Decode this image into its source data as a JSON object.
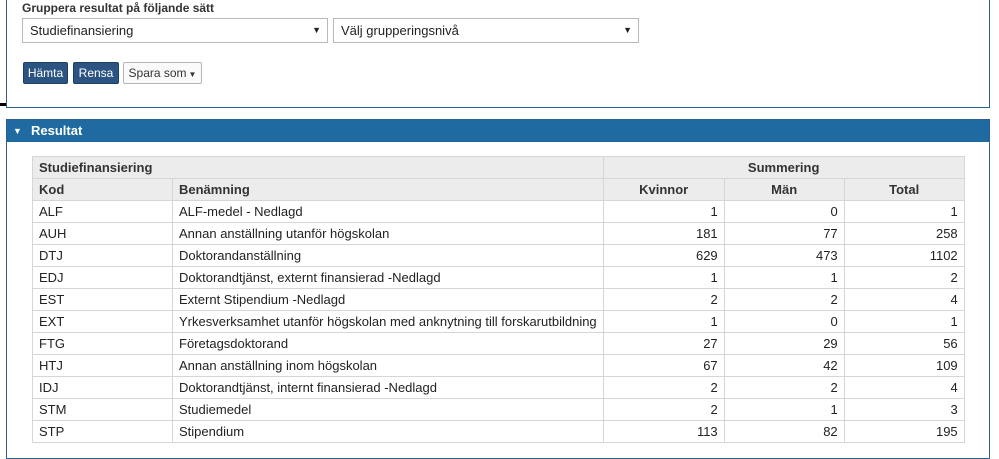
{
  "grouping": {
    "label": "Gruppera resultat på följande sätt",
    "primary_select": "Studiefinansiering",
    "secondary_select": "Välj grupperingsnivå"
  },
  "actions": {
    "fetch": "Hämta",
    "clear": "Rensa",
    "save_as": "Spara som"
  },
  "results": {
    "title": "Resultat",
    "group_header": "Studiefinansiering",
    "summary_header": "Summering",
    "columns": [
      "Kod",
      "Benämning",
      "Kvinnor",
      "Män",
      "Total"
    ],
    "rows": [
      {
        "kod": "ALF",
        "benamning": "ALF-medel - Nedlagd",
        "kvinnor": "1",
        "man": "0",
        "total": "1"
      },
      {
        "kod": "AUH",
        "benamning": "Annan anställning utanför högskolan",
        "kvinnor": "181",
        "man": "77",
        "total": "258"
      },
      {
        "kod": "DTJ",
        "benamning": "Doktorandanställning",
        "kvinnor": "629",
        "man": "473",
        "total": "1102"
      },
      {
        "kod": "EDJ",
        "benamning": "Doktorandtjänst, externt finansierad -Nedlagd",
        "kvinnor": "1",
        "man": "1",
        "total": "2"
      },
      {
        "kod": "EST",
        "benamning": "Externt Stipendium -Nedlagd",
        "kvinnor": "2",
        "man": "2",
        "total": "4"
      },
      {
        "kod": "EXT",
        "benamning": "Yrkesverksamhet utanför högskolan med anknytning till forskarutbildning",
        "kvinnor": "1",
        "man": "0",
        "total": "1"
      },
      {
        "kod": "FTG",
        "benamning": "Företagsdoktorand",
        "kvinnor": "27",
        "man": "29",
        "total": "56"
      },
      {
        "kod": "HTJ",
        "benamning": "Annan anställning inom högskolan",
        "kvinnor": "67",
        "man": "42",
        "total": "109"
      },
      {
        "kod": "IDJ",
        "benamning": "Doktorandtjänst, internt finansierad -Nedlagd",
        "kvinnor": "2",
        "man": "2",
        "total": "4"
      },
      {
        "kod": "STM",
        "benamning": "Studiemedel",
        "kvinnor": "2",
        "man": "1",
        "total": "3"
      },
      {
        "kod": "STP",
        "benamning": "Stipendium",
        "kvinnor": "113",
        "man": "82",
        "total": "195"
      }
    ]
  }
}
